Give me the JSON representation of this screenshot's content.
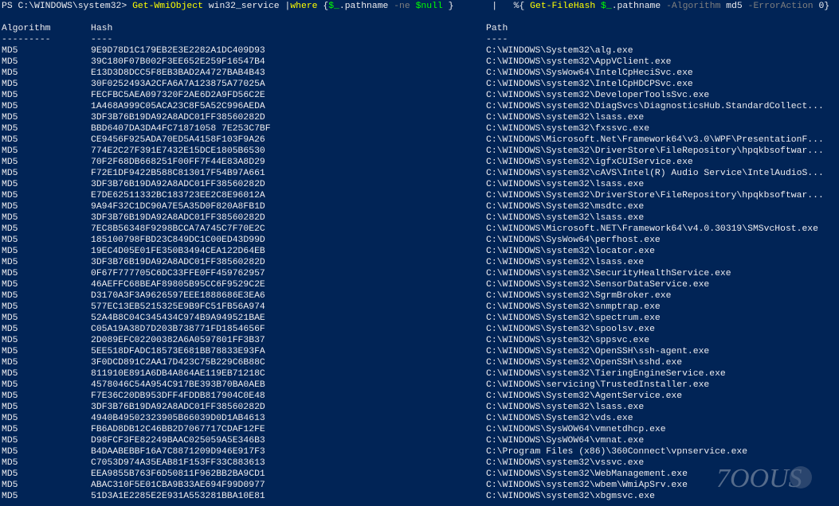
{
  "command": {
    "prompt": "PS C:\\WINDOWS\\system32> ",
    "cmdlet1": "Get-WmiObject",
    "arg1": " win32_service ",
    "pipe1": "|",
    "where_kw": "where",
    "brace_open": " {",
    "var1": "$_",
    "prop1": ".pathname ",
    "op_ne": "-ne",
    "space1": " ",
    "null_var": "$null",
    "brace_close": " }",
    "pipe_gap": "       |   ",
    "foreach": "%",
    "brace_open2": "{ ",
    "cmdlet2": "Get-FileHash",
    "space2": " ",
    "var2": "$_",
    "prop2": ".pathname ",
    "param_alg": "-Algorithm",
    "alg_value": " md5 ",
    "param_err": "-ErrorAction",
    "err_value": " 0}"
  },
  "headers": {
    "algorithm": "Algorithm",
    "hash": "Hash",
    "path": "Path",
    "algorithm_ul": "---------",
    "hash_ul": "----",
    "path_ul": "----"
  },
  "rows": [
    {
      "algorithm": "MD5",
      "hash": "9E9D78D1C179EB2E3E2282A1DC409D93",
      "path": "C:\\WINDOWS\\System32\\alg.exe"
    },
    {
      "algorithm": "MD5",
      "hash": "39C180F07B002F3EE652E259F16547B4",
      "path": "C:\\WINDOWS\\system32\\AppVClient.exe"
    },
    {
      "algorithm": "MD5",
      "hash": "E13D3D8DCC5F8EB3BAD2A4727BAB4B43",
      "path": "C:\\WINDOWS\\SysWow64\\IntelCpHeciSvc.exe"
    },
    {
      "algorithm": "MD5",
      "hash": "30F0252493A2CFA6A7A123875A77025A",
      "path": "C:\\WINDOWS\\system32\\IntelCpHDCPSvc.exe"
    },
    {
      "algorithm": "MD5",
      "hash": "FECFBC5AEA097320F2AE6D2A9FD56C2E",
      "path": "C:\\WINDOWS\\system32\\DeveloperToolsSvc.exe"
    },
    {
      "algorithm": "MD5",
      "hash": "1A468A999C05ACA23C8F5A52C996AEDA",
      "path": "C:\\WINDOWS\\system32\\DiagSvcs\\DiagnosticsHub.StandardCollect..."
    },
    {
      "algorithm": "MD5",
      "hash": "3DF3B76B19DA92A8ADC01FF38560282D",
      "path": "C:\\WINDOWS\\system32\\lsass.exe"
    },
    {
      "algorithm": "MD5",
      "hash": "BBD6407DA3DA4FC71871058 7E253C7BF",
      "path": "C:\\WINDOWS\\system32\\fxssvc.exe"
    },
    {
      "algorithm": "MD5",
      "hash": "CE9456F925ADA70ED5A4158F103F9A26",
      "path": "C:\\WINDOWS\\Microsoft.Net\\Framework64\\v3.0\\WPF\\PresentationF..."
    },
    {
      "algorithm": "MD5",
      "hash": "774E2C27F391E7432E15DCE1805B6530",
      "path": "C:\\WINDOWS\\System32\\DriverStore\\FileRepository\\hpqkbsoftwar..."
    },
    {
      "algorithm": "MD5",
      "hash": "70F2F68DB668251F00FF7F44E83A8D29",
      "path": "C:\\WINDOWS\\system32\\igfxCUIService.exe"
    },
    {
      "algorithm": "MD5",
      "hash": "F72E1DF9422B588C813017F54B97A661",
      "path": "C:\\WINDOWS\\system32\\cAVS\\Intel(R) Audio Service\\IntelAudioS..."
    },
    {
      "algorithm": "MD5",
      "hash": "3DF3B76B19DA92A8ADC01FF38560282D",
      "path": "C:\\WINDOWS\\system32\\lsass.exe"
    },
    {
      "algorithm": "MD5",
      "hash": "E7DE62511332BC183723EE2C8E96012A",
      "path": "C:\\WINDOWS\\System32\\DriverStore\\FileRepository\\hpqkbsoftwar..."
    },
    {
      "algorithm": "MD5",
      "hash": "9A94F32C1DC90A7E5A35D0F820A8FB1D",
      "path": "C:\\WINDOWS\\System32\\msdtc.exe"
    },
    {
      "algorithm": "MD5",
      "hash": "3DF3B76B19DA92A8ADC01FF38560282D",
      "path": "C:\\WINDOWS\\system32\\lsass.exe"
    },
    {
      "algorithm": "MD5",
      "hash": "7EC8B56348F9298BCCA7A745C7F70E2C",
      "path": "C:\\WINDOWS\\Microsoft.NET\\Framework64\\v4.0.30319\\SMSvcHost.exe"
    },
    {
      "algorithm": "MD5",
      "hash": "185100798FBD23C849DC1C00ED43D99D",
      "path": "C:\\WINDOWS\\SysWow64\\perfhost.exe"
    },
    {
      "algorithm": "MD5",
      "hash": "19EC4D05E01FE350B3494CEA122D64EB",
      "path": "C:\\WINDOWS\\system32\\locator.exe"
    },
    {
      "algorithm": "MD5",
      "hash": "3DF3B76B19DA92A8ADC01FF38560282D",
      "path": "C:\\WINDOWS\\system32\\lsass.exe"
    },
    {
      "algorithm": "MD5",
      "hash": "0F67F777705C6DC33FFE0FF459762957",
      "path": "C:\\WINDOWS\\system32\\SecurityHealthService.exe"
    },
    {
      "algorithm": "MD5",
      "hash": "46AEFFC68BEAF89805B95CC6F9529C2E",
      "path": "C:\\WINDOWS\\System32\\SensorDataService.exe"
    },
    {
      "algorithm": "MD5",
      "hash": "D3170A3F3A9626597EEE1888686E3EA6",
      "path": "C:\\WINDOWS\\system32\\SgrmBroker.exe"
    },
    {
      "algorithm": "MD5",
      "hash": "577EC13EB5215325E9B9FC51FB56A974",
      "path": "C:\\WINDOWS\\System32\\snmptrap.exe"
    },
    {
      "algorithm": "MD5",
      "hash": "52A4B8C04C345434C974B9A949521BAE",
      "path": "C:\\WINDOWS\\System32\\spectrum.exe"
    },
    {
      "algorithm": "MD5",
      "hash": "C05A19A38D7D203B738771FD1854656F",
      "path": "C:\\WINDOWS\\System32\\spoolsv.exe"
    },
    {
      "algorithm": "MD5",
      "hash": "2D089EFC02200382A6A0597801FF3B37",
      "path": "C:\\WINDOWS\\system32\\sppsvc.exe"
    },
    {
      "algorithm": "MD5",
      "hash": "5EE518DFADC18573E681BB78833E93FA",
      "path": "C:\\WINDOWS\\System32\\OpenSSH\\ssh-agent.exe"
    },
    {
      "algorithm": "MD5",
      "hash": "3F0DCD891C2AA17D423C75B229C6B88C",
      "path": "C:\\WINDOWS\\System32\\OpenSSH\\sshd.exe"
    },
    {
      "algorithm": "MD5",
      "hash": "811910E891A6DB4A864AE119EB71218C",
      "path": "C:\\WINDOWS\\system32\\TieringEngineService.exe"
    },
    {
      "algorithm": "MD5",
      "hash": "4578046C54A954C917BE393B70BA0AEB",
      "path": "C:\\WINDOWS\\servicing\\TrustedInstaller.exe"
    },
    {
      "algorithm": "MD5",
      "hash": "F7E36C20DB953DFF4FDDB817904C0E48",
      "path": "C:\\WINDOWS\\System32\\AgentService.exe"
    },
    {
      "algorithm": "MD5",
      "hash": "3DF3B76B19DA92A8ADC01FF38560282D",
      "path": "C:\\WINDOWS\\system32\\lsass.exe"
    },
    {
      "algorithm": "MD5",
      "hash": "4940B49502323905B66039D0D1AB4613",
      "path": "C:\\WINDOWS\\System32\\vds.exe"
    },
    {
      "algorithm": "MD5",
      "hash": "FB6AD8DB12C46BB2D7067717CDAF12FE",
      "path": "C:\\WINDOWS\\SysWOW64\\vmnetdhcp.exe"
    },
    {
      "algorithm": "MD5",
      "hash": "D98FCF3FE82249BAAC025059A5E346B3",
      "path": "C:\\WINDOWS\\SysWOW64\\vmnat.exe"
    },
    {
      "algorithm": "MD5",
      "hash": "B4DAABEBBF16A7C8871209D946E917F3",
      "path": "C:\\Program Files (x86)\\360Connect\\vpnservice.exe"
    },
    {
      "algorithm": "MD5",
      "hash": "C7053D974A35EAB81F153FF33C883613",
      "path": "C:\\WINDOWS\\system32\\vssvc.exe"
    },
    {
      "algorithm": "MD5",
      "hash": "EEA9855B763F6D50811F962BB2BA9CD1",
      "path": "C:\\WINDOWS\\System32\\WebManagement.exe"
    },
    {
      "algorithm": "MD5",
      "hash": "ABAC310F5E01CBA9B33AE694F99D0977",
      "path": "C:\\WINDOWS\\system32\\wbem\\WmiApSrv.exe"
    },
    {
      "algorithm": "MD5",
      "hash": "51D3A1E2285E2E931A553281BBA10E81",
      "path": "C:\\WINDOWS\\system32\\xbgmsvc.exe"
    }
  ],
  "watermark": {
    "text": "7OOUS"
  },
  "colors": {
    "background": "#012456",
    "foreground": "#eeedf0",
    "cmdlet": "#ffff00",
    "variable": "#00ff00",
    "parameter": "#7f7f7f"
  }
}
